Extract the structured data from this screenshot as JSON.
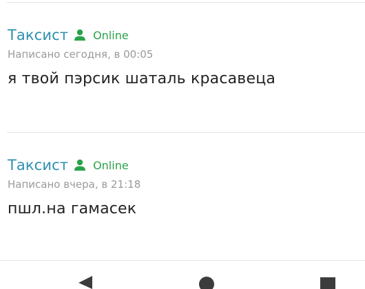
{
  "posts": [
    {
      "author": "Таксист",
      "status": "Online",
      "meta": "Написано сегодня, в 00:05",
      "message": "я твой пэрсик шаталь красавеца"
    },
    {
      "author": "Таксист",
      "status": "Online",
      "meta": "Написано вчера, в 21:18",
      "message": "пшл.на гамасек"
    }
  ],
  "icons": {
    "user": "user-icon",
    "back": "back-triangle-icon",
    "home": "home-circle-icon",
    "recents": "recents-square-icon"
  },
  "colors": {
    "author": "#2d8fb0",
    "online": "#2aa24a",
    "meta": "#9a9a9a",
    "text": "#222222",
    "nav": "#3c3c3c"
  }
}
